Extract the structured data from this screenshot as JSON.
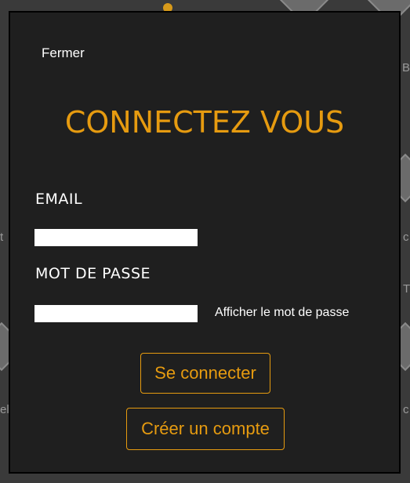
{
  "modal": {
    "close_label": "Fermer",
    "title": "CONNECTEZ VOUS",
    "email_label": "EMAIL",
    "email_value": "",
    "password_label": "MOT DE PASSE",
    "password_value": "",
    "show_password_label": "Afficher le mot de passe",
    "login_button": "Se connecter",
    "create_account_button": "Créer un compte"
  },
  "background": {
    "left_text_1": "t",
    "left_text_2": "el",
    "right_text_1": "Ba",
    "right_text_2": "c",
    "right_text_3": "T",
    "right_text_4": "c"
  },
  "colors": {
    "accent": "#e69b10",
    "modal_bg": "#1f1f1f",
    "text": "#ffffff",
    "input_bg": "#ffffff"
  }
}
